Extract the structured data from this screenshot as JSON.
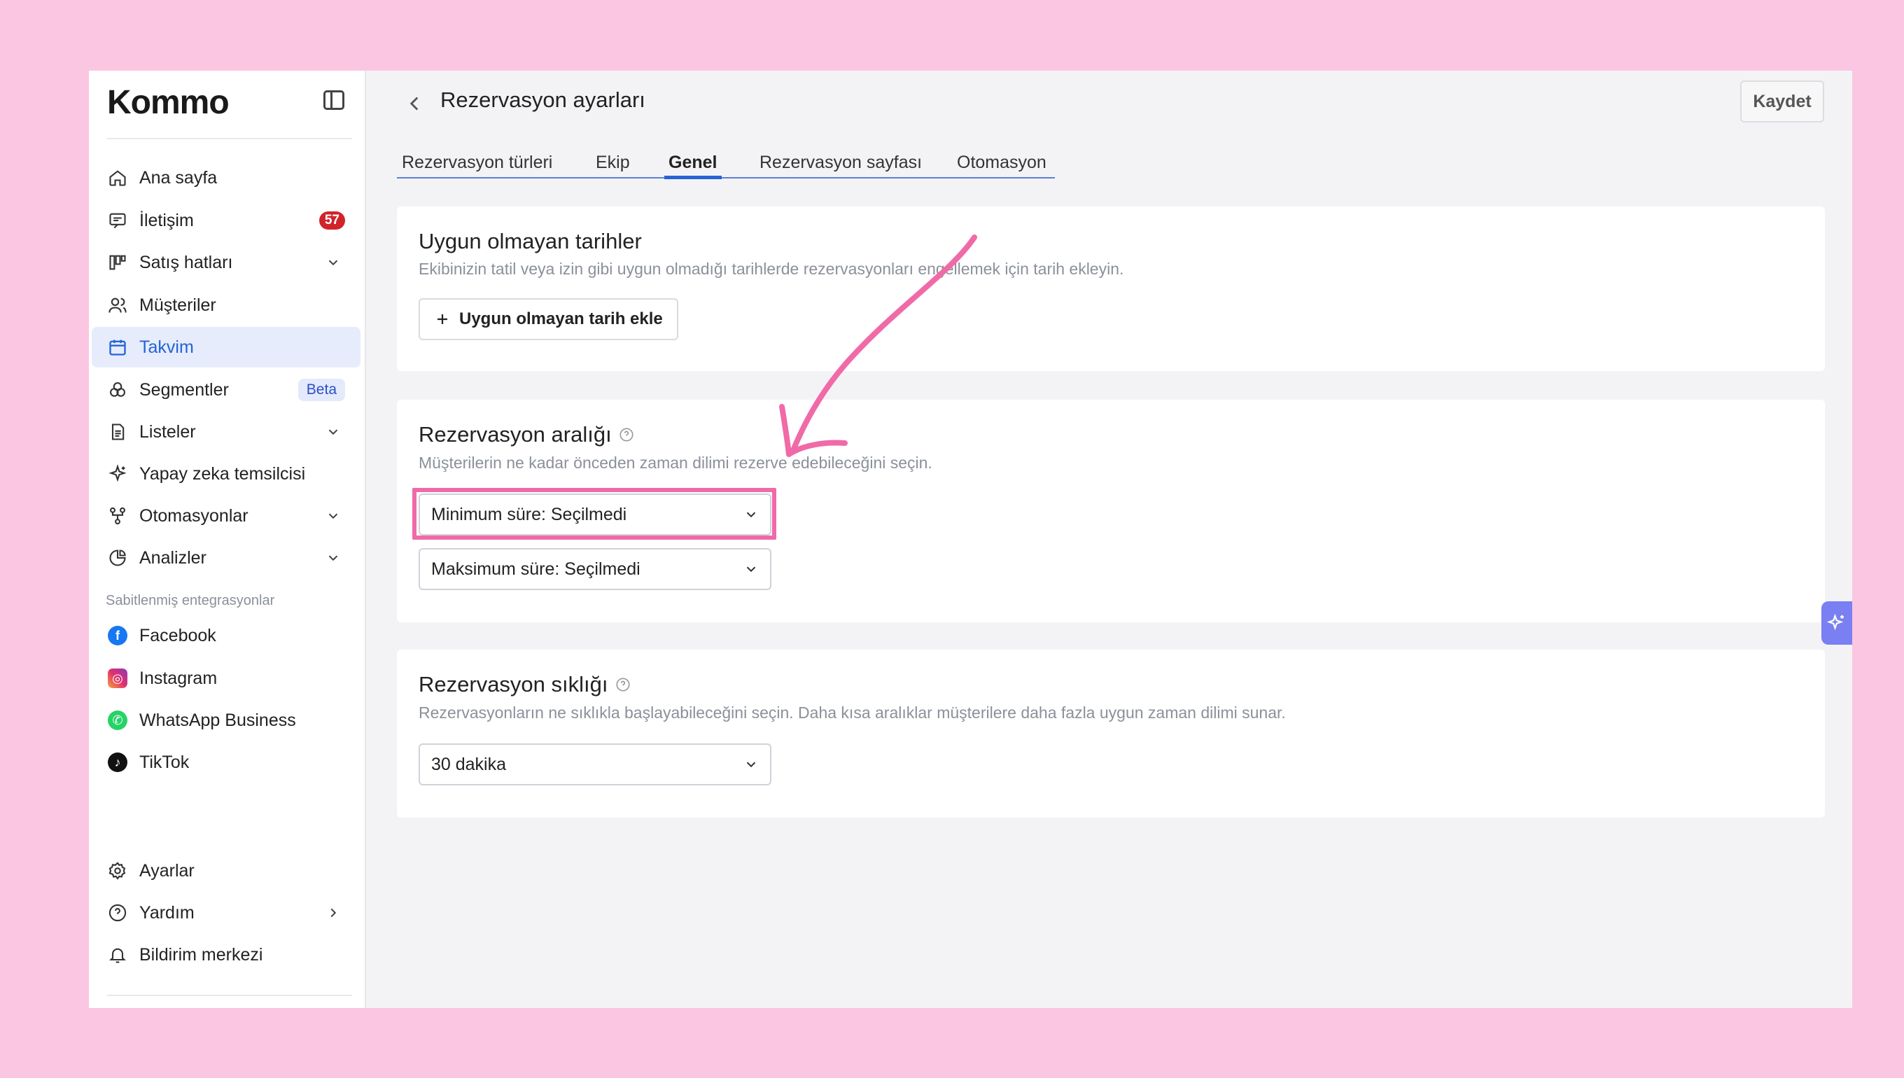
{
  "app": {
    "logo_text": "Kommo"
  },
  "sidebar": {
    "items": [
      {
        "label": "Ana sayfa",
        "icon": "home-icon"
      },
      {
        "label": "İletişim",
        "icon": "chat-icon",
        "badge": "57"
      },
      {
        "label": "Satış hatları",
        "icon": "pipeline-icon"
      },
      {
        "label": "Müşteriler",
        "icon": "users-icon"
      },
      {
        "label": "Takvim",
        "icon": "calendar-icon"
      },
      {
        "label": "Segmentler",
        "icon": "segments-icon",
        "badge": "Beta"
      },
      {
        "label": "Listeler",
        "icon": "list-icon"
      },
      {
        "label": "Yapay zeka temsilcisi",
        "icon": "sparkle-icon"
      },
      {
        "label": "Otomasyonlar",
        "icon": "automation-icon"
      },
      {
        "label": "Analizler",
        "icon": "analytics-icon"
      }
    ],
    "pinned_section_title": "Sabitlenmiş entegrasyonlar",
    "integrations": [
      {
        "label": "Facebook",
        "icon": "facebook-icon",
        "color": "#1877f2"
      },
      {
        "label": "Instagram",
        "icon": "instagram-icon",
        "color": "#e1306c"
      },
      {
        "label": "WhatsApp Business",
        "icon": "whatsapp-icon",
        "color": "#25d366"
      },
      {
        "label": "TikTok",
        "icon": "tiktok-icon",
        "color": "#111111"
      }
    ],
    "bottom": [
      {
        "label": "Ayarlar",
        "icon": "gear-icon"
      },
      {
        "label": "Yardım",
        "icon": "help-icon"
      },
      {
        "label": "Bildirim merkezi",
        "icon": "bell-icon"
      }
    ]
  },
  "header": {
    "title": "Rezervasyon ayarları",
    "save_label": "Kaydet"
  },
  "tabs": [
    {
      "label": "Rezervasyon türleri"
    },
    {
      "label": "Ekip"
    },
    {
      "label": "Genel",
      "active": true
    },
    {
      "label": "Rezervasyon sayfası"
    },
    {
      "label": "Otomasyon"
    }
  ],
  "unavailable_dates": {
    "title": "Uygun olmayan tarihler",
    "description": "Ekibinizin tatil veya izin gibi uygun olmadığı tarihlerde rezervasyonları engellemek için tarih ekleyin.",
    "add_button": "Uygun olmayan tarih ekle"
  },
  "booking_range": {
    "title": "Rezervasyon aralığı",
    "description": "Müşterilerin ne kadar önceden zaman dilimi rezerve edebileceğini seçin.",
    "min_select": "Minimum süre: Seçilmedi",
    "max_select": "Maksimum süre: Seçilmedi"
  },
  "booking_frequency": {
    "title": "Rezervasyon sıklığı",
    "description": "Rezervasyonların ne sıklıkla başlayabileceğini seçin. Daha kısa aralıklar müşterilere daha fazla uygun zaman dilimi sunar.",
    "select": "30 dakika"
  },
  "colors": {
    "accent": "#2563d6",
    "annotation": "#f06aa8",
    "background": "#fbc6e1"
  }
}
